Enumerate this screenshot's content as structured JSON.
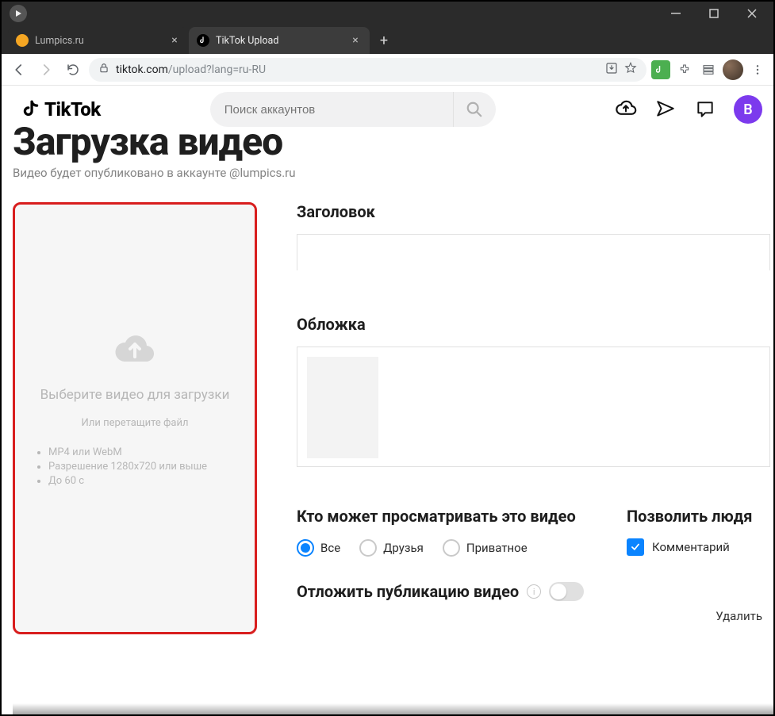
{
  "window": {
    "tabs": [
      {
        "title": "Lumpics.ru",
        "favicon_color": "#f5a623",
        "active": false
      },
      {
        "title": "TikTok Upload",
        "favicon_color": "#000000",
        "active": true
      }
    ]
  },
  "omnibox": {
    "host": "tiktok.com",
    "path": "/upload?lang=ru-RU"
  },
  "tiktok_header": {
    "brand": "TikTok",
    "search_placeholder": "Поиск аккаунтов",
    "avatar_letter": "B",
    "avatar_color": "#7c3aed"
  },
  "page": {
    "title": "Загрузка видео",
    "subtitle": "Видео будет опубликовано в аккаунте @lumpics.ru"
  },
  "upload_card": {
    "main": "Выберите видео для загрузки",
    "sub": "Или перетащите файл",
    "bullets": [
      "MP4 или WebM",
      "Разрешение 1280x720 или выше",
      "До 60 с"
    ]
  },
  "form": {
    "title_label": "Заголовок",
    "title_value": "",
    "cover_label": "Обложка",
    "view_label": "Кто может просматривать это видео",
    "view_options": [
      {
        "label": "Все",
        "selected": true
      },
      {
        "label": "Друзья",
        "selected": false
      },
      {
        "label": "Приватное",
        "selected": false
      }
    ],
    "allow_label": "Позволить людя",
    "allow_comment": {
      "label": "Комментарий",
      "checked": true
    },
    "schedule_label": "Отложить публикацию видео",
    "schedule_on": false,
    "delete_label": "Удалить"
  }
}
